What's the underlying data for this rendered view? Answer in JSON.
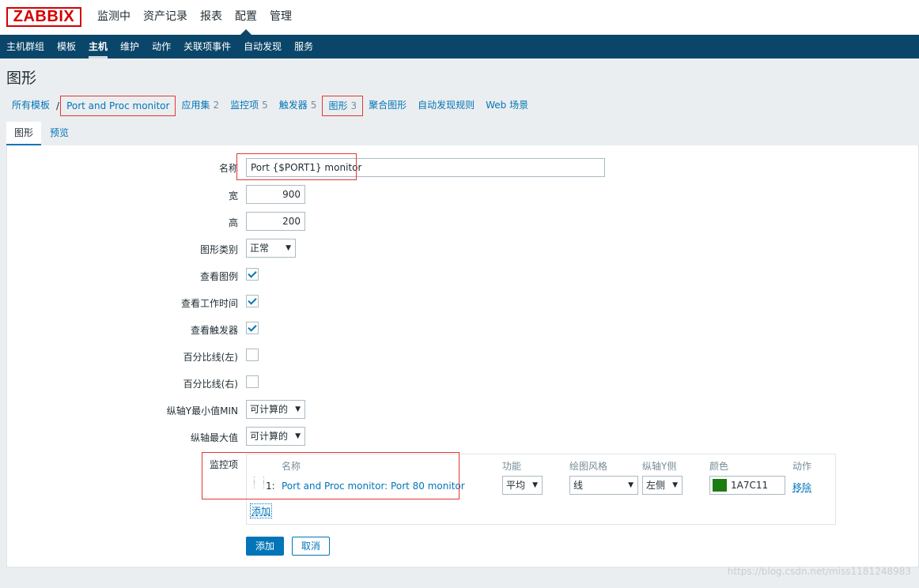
{
  "logo": "ZABBIX",
  "top_menu": [
    "监测中",
    "资产记录",
    "报表",
    "配置",
    "管理"
  ],
  "sub_menu": [
    "主机群组",
    "模板",
    "主机",
    "维护",
    "动作",
    "关联项事件",
    "自动发现",
    "服务"
  ],
  "page_title": "图形",
  "breadcrumbs": {
    "all_templates": "所有模板",
    "separator": "/",
    "template": "Port and Proc monitor",
    "applications": "应用集",
    "applications_count": "2",
    "items": "监控项",
    "items_count": "5",
    "triggers": "触发器",
    "triggers_count": "5",
    "graphs": "图形",
    "graphs_count": "3",
    "screens": "聚合图形",
    "discovery": "自动发现规则",
    "web": "Web 场景"
  },
  "tabs": [
    "图形",
    "预览"
  ],
  "form": {
    "name_label": "名称",
    "name_value": "Port  {$PORT1} monitor",
    "width_label": "宽",
    "width_value": "900",
    "height_label": "高",
    "height_value": "200",
    "graph_type_label": "图形类别",
    "graph_type_value": "正常",
    "show_legend_label": "查看图例",
    "show_working_time_label": "查看工作时间",
    "show_triggers_label": "查看触发器",
    "percentile_left_label": "百分比线(左)",
    "percentile_right_label": "百分比线(右)",
    "ymin_label": "纵轴Y最小值MIN",
    "ymin_value": "可计算的",
    "ymax_label": "纵轴最大值",
    "ymax_value": "可计算的",
    "items_label": "监控项"
  },
  "checkboxes": {
    "show_legend": true,
    "show_working_time": true,
    "show_triggers": true,
    "percentile_left": false,
    "percentile_right": false
  },
  "items_table": {
    "headers": {
      "name": "名称",
      "function": "功能",
      "draw_style": "绘图风格",
      "y_axis_side": "纵轴Y侧",
      "color": "颜色",
      "action": "动作"
    },
    "rows": [
      {
        "index": "1:",
        "name": "Port and Proc monitor: Port 80 monitor",
        "function": "平均",
        "draw_style": "线",
        "y_axis_side": "左侧",
        "color": "1A7C11",
        "color_hex": "#1A7C11",
        "remove": "移除"
      }
    ],
    "add_link": "添加"
  },
  "buttons": {
    "add": "添加",
    "cancel": "取消"
  },
  "watermark": "https://blog.csdn.net/miss1181248983"
}
